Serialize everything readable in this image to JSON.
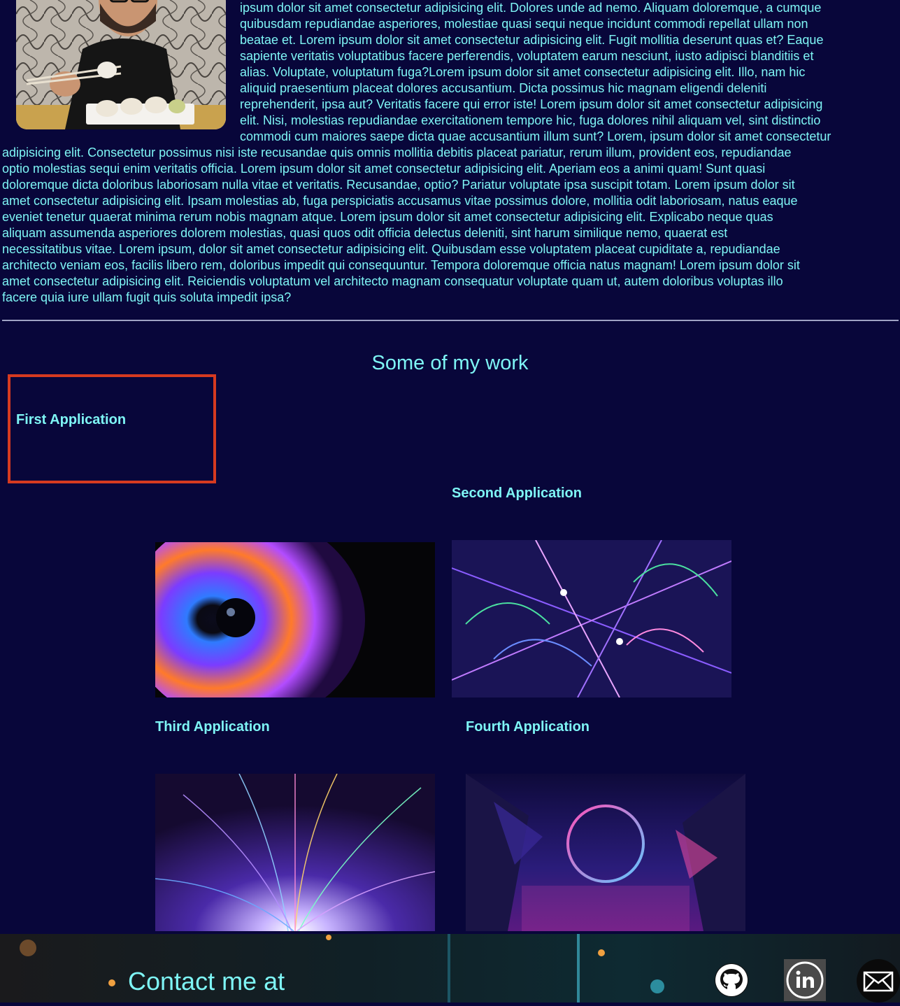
{
  "about": {
    "float_lines": [
      "ipsum dolor sit amet consectetur adipisicing elit. Dolores unde ad nemo. Aliquam doloremque, a cumque",
      "quibusdam repudiandae asperiores, molestiae quasi sequi neque incidunt commodi repellat ullam non",
      "beatae et. Lorem ipsum dolor sit amet consectetur adipisicing elit. Fugit mollitia deserunt quas et? Eaque",
      "sapiente veritatis voluptatibus facere perferendis, voluptatem earum nesciunt, iusto adipisci blanditiis et",
      "alias. Voluptate, voluptatum fuga?Lorem ipsum dolor sit amet consectetur adipisicing elit. Illo, nam hic",
      "aliquid praesentium placeat dolores accusantium. Dicta possimus hic magnam eligendi deleniti",
      "reprehenderit, ipsa aut? Veritatis facere qui error iste! Lorem ipsum dolor sit amet consectetur adipisicing",
      "elit. Nisi, molestias repudiandae exercitationem tempore hic, fuga dolores nihil aliquam vel, sint distinctio",
      "commodi cum maiores saepe dicta quae accusantium illum sunt? Lorem, ipsum dolor sit amet consectetur"
    ],
    "full_lines": [
      "adipisicing elit. Consectetur possimus nisi iste recusandae quis omnis mollitia debitis placeat pariatur, rerum illum, provident eos, repudiandae",
      "optio molestias sequi enim veritatis officia. Lorem ipsum dolor sit amet consectetur adipisicing elit. Aperiam eos a animi quam! Sunt quasi",
      "doloremque dicta doloribus laboriosam nulla vitae et veritatis. Recusandae, optio? Pariatur voluptate ipsa suscipit totam. Lorem ipsum dolor sit",
      "amet consectetur adipisicing elit. Ipsam molestias ab, fuga perspiciatis accusamus vitae possimus dolore, mollitia odit laboriosam, natus eaque",
      "eveniet tenetur quaerat minima rerum nobis magnam atque. Lorem ipsum dolor sit amet consectetur adipisicing elit. Explicabo neque quas",
      "aliquam assumenda asperiores dolorem molestias, quasi quos odit officia delectus deleniti, sint harum similique nemo, quaerat est",
      "necessitatibus vitae. Lorem ipsum, dolor sit amet consectetur adipisicing elit. Quibusdam esse voluptatem placeat cupiditate a, repudiandae",
      "architecto veniam eos, facilis libero rem, doloribus impedit qui consequuntur. Tempora doloremque officia natus magnam! Lorem ipsum dolor sit",
      "amet consectetur adipisicing elit. Reiciendis voluptatum vel architecto magnam consequatur voluptate quam ut, autem doloribus voluptas illo",
      "facere quia iure ullam fugit quis soluta impedit ipsa?"
    ]
  },
  "work": {
    "title": "Some of my work",
    "apps": [
      {
        "label": "First Application"
      },
      {
        "label": "Second Application"
      },
      {
        "label": "Third Application"
      },
      {
        "label": "Fourth Application"
      }
    ]
  },
  "footer": {
    "contact_text": "Contact me at",
    "icons": [
      "github-icon",
      "linkedin-icon",
      "mail-icon"
    ]
  },
  "colors": {
    "background": "#08063a",
    "text": "#7ef5f5",
    "highlight_border": "#d63a20"
  }
}
